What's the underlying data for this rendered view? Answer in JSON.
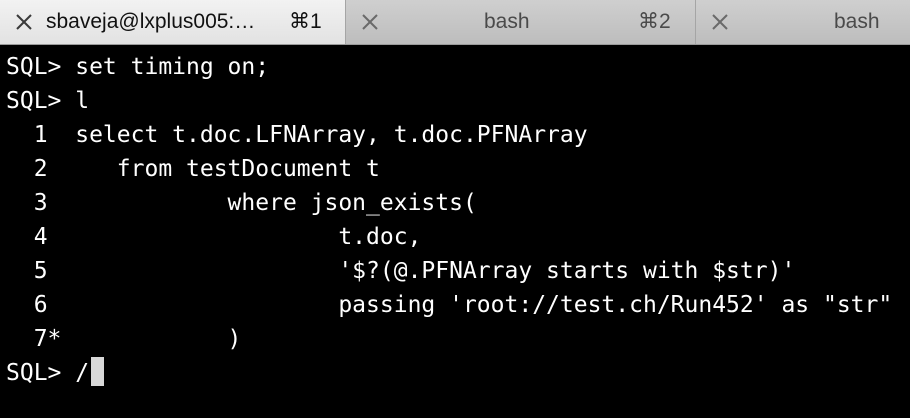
{
  "tabs": [
    {
      "title": "sbaveja@lxplus005:…",
      "shortcut": "⌘1",
      "active": true,
      "close_icon": "close-icon"
    },
    {
      "title": "bash",
      "shortcut": "⌘2",
      "active": false,
      "close_icon": "close-icon"
    },
    {
      "title": "bash",
      "shortcut": "",
      "active": false,
      "close_icon": "close-icon"
    }
  ],
  "terminal": {
    "lines": [
      "SQL> set timing on;",
      "SQL> l",
      "  1  select t.doc.LFNArray, t.doc.PFNArray",
      "  2     from testDocument t",
      "  3             where json_exists(",
      "  4                     t.doc,",
      "  5                     '$?(@.PFNArray starts with $str)'",
      "  6                     passing 'root://test.ch/Run452' as \"str\"",
      "  7*            )",
      "SQL> /"
    ]
  },
  "colors": {
    "terminal_background": "#000000",
    "terminal_text": "#ffffff",
    "cursor": "#d8d8d8",
    "active_tab": "#e8e8e8",
    "inactive_tab": "#c4c4c4"
  }
}
